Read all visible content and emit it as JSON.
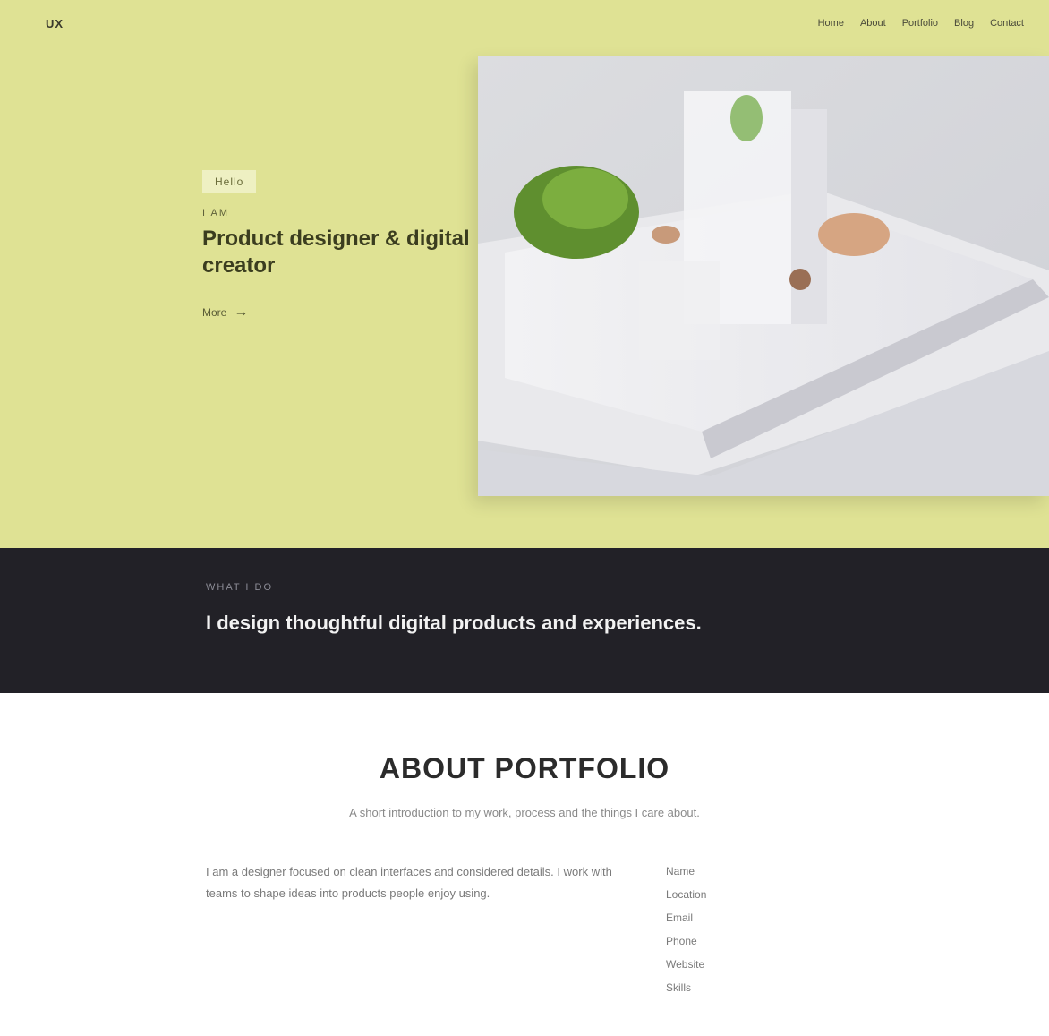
{
  "brand": {
    "logo_text": "UX"
  },
  "nav": {
    "items": [
      "Home",
      "About",
      "Portfolio",
      "Blog",
      "Contact"
    ]
  },
  "hero": {
    "kicker": "Hello",
    "eyebrow": "I AM",
    "title": "Product designer & digital creator",
    "cta_label": "More",
    "bg_color": "#dfe294"
  },
  "quote": {
    "label": "WHAT I DO",
    "text": "I design thoughtful digital products and experiences."
  },
  "about": {
    "title": "ABOUT PORTFOLIO",
    "subtitle": "A short introduction to my work, process and the things I care about.",
    "body": "I am a designer focused on clean interfaces and considered details. I work with teams to shape ideas into products people enjoy using.",
    "list": [
      "Name",
      "Location",
      "Email",
      "Phone",
      "Website",
      "Skills"
    ]
  }
}
